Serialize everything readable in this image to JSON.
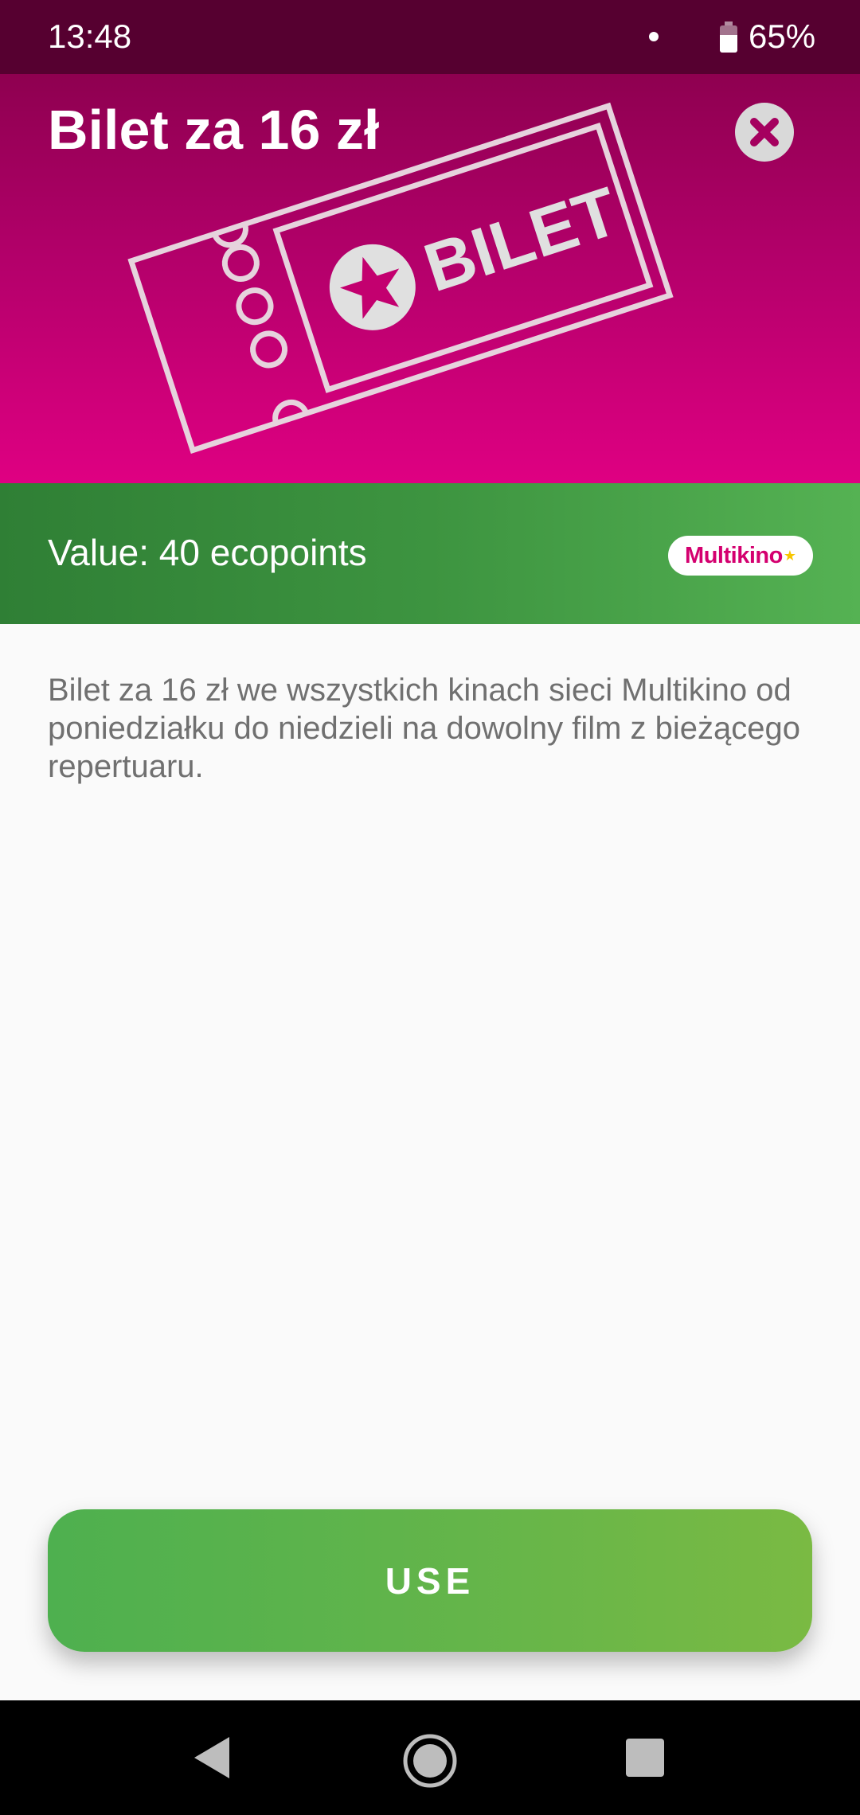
{
  "status_bar": {
    "time": "13:48",
    "battery_percent_label": "65%",
    "battery_level": 0.65
  },
  "header": {
    "title": "Bilet za 16 zł",
    "illustration_text": "BILET",
    "close_icon": "close-circle-icon",
    "colors": {
      "top": "#8e0050",
      "bottom": "#df0082"
    }
  },
  "value_band": {
    "value_text": "Value: 40 ecopoints",
    "brand_logo_text": "Multikino",
    "colors": {
      "left": "#2f7f35",
      "right": "#55b253"
    }
  },
  "description": "Bilet za 16 zł we wszystkich kinach sieci Multikino od poniedziałku do niedzieli na dowolny film z bieżącego repertuaru.",
  "use_button": {
    "label": "USE",
    "color": "#6ab84b"
  },
  "nav_bar": {
    "back_icon": "back-triangle-icon",
    "home_icon": "home-circle-icon",
    "recents_icon": "recents-square-icon"
  }
}
